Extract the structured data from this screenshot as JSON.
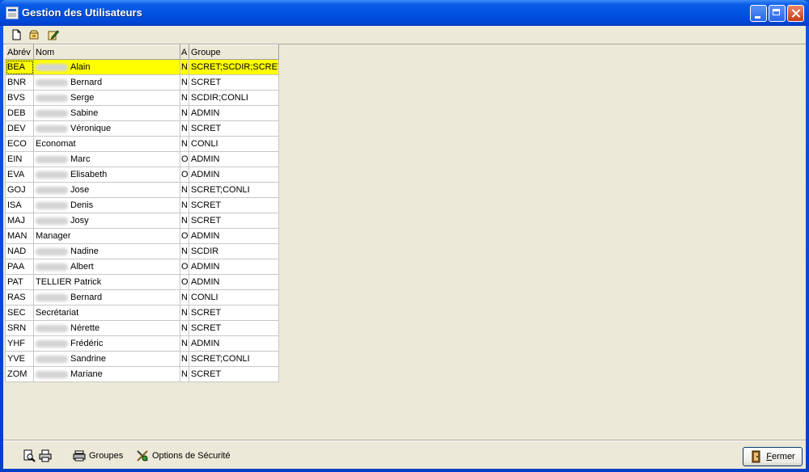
{
  "window": {
    "title": "Gestion des Utilisateurs"
  },
  "toolbar": {
    "icons": [
      "new-document-icon",
      "open-bag-icon",
      "edit-pencil-icon"
    ]
  },
  "grid": {
    "columns": [
      "Abrév",
      "Nom",
      "A",
      "Groupe"
    ],
    "rows": [
      {
        "abrev": "BEA",
        "nom": "Alain",
        "a": "N",
        "groupe": "SCRET;SCDIR;SCRET",
        "masked": true
      },
      {
        "abrev": "BNR",
        "nom": "Bernard",
        "a": "N",
        "groupe": "SCRET",
        "masked": true
      },
      {
        "abrev": "BVS",
        "nom": "Serge",
        "a": "N",
        "groupe": "SCDIR;CONLI",
        "masked": true
      },
      {
        "abrev": "DEB",
        "nom": "Sabine",
        "a": "N",
        "groupe": "ADMIN",
        "masked": true
      },
      {
        "abrev": "DEV",
        "nom": "Véronique",
        "a": "N",
        "groupe": "SCRET",
        "masked": true
      },
      {
        "abrev": "ECO",
        "nom": "Economat",
        "a": "N",
        "groupe": "CONLI",
        "masked": false
      },
      {
        "abrev": "EIN",
        "nom": "Marc",
        "a": "O",
        "groupe": "ADMIN",
        "masked": true
      },
      {
        "abrev": "EVA",
        "nom": "Elisabeth",
        "a": "O",
        "groupe": "ADMIN",
        "masked": true
      },
      {
        "abrev": "GOJ",
        "nom": "Jose",
        "a": "N",
        "groupe": "SCRET;CONLI",
        "masked": true
      },
      {
        "abrev": "ISA",
        "nom": "Denis",
        "a": "N",
        "groupe": "SCRET",
        "masked": true
      },
      {
        "abrev": "MAJ",
        "nom": "Josy",
        "a": "N",
        "groupe": "SCRET",
        "masked": true
      },
      {
        "abrev": "MAN",
        "nom": "Manager",
        "a": "O",
        "groupe": "ADMIN",
        "masked": false
      },
      {
        "abrev": "NAD",
        "nom": "Nadine",
        "a": "N",
        "groupe": "SCDIR",
        "masked": true
      },
      {
        "abrev": "PAA",
        "nom": "Albert",
        "a": "O",
        "groupe": "ADMIN",
        "masked": true
      },
      {
        "abrev": "PAT",
        "nom": "TELLIER Patrick",
        "a": "O",
        "groupe": "ADMIN",
        "masked": false
      },
      {
        "abrev": "RAS",
        "nom": "Bernard",
        "a": "N",
        "groupe": "CONLI",
        "masked": true
      },
      {
        "abrev": "SEC",
        "nom": "Secrétariat",
        "a": "N",
        "groupe": "SCRET",
        "masked": false
      },
      {
        "abrev": "SRN",
        "nom": "Nérette",
        "a": "N",
        "groupe": "SCRET",
        "masked": true
      },
      {
        "abrev": "YHF",
        "nom": "Frédéric",
        "a": "N",
        "groupe": "ADMIN",
        "masked": true
      },
      {
        "abrev": "YVE",
        "nom": "Sandrine",
        "a": "N",
        "groupe": "SCRET;CONLI",
        "masked": true
      },
      {
        "abrev": "ZOM",
        "nom": "Mariane",
        "a": "N",
        "groupe": "SCRET",
        "masked": true
      }
    ],
    "selected_index": 0,
    "selected_color": "#ffff00"
  },
  "bottom": {
    "groupes_label": "Groupes",
    "options_label": "Options de Sécurité",
    "fermer_label": "ermer",
    "fermer_mnemonic": "F"
  }
}
